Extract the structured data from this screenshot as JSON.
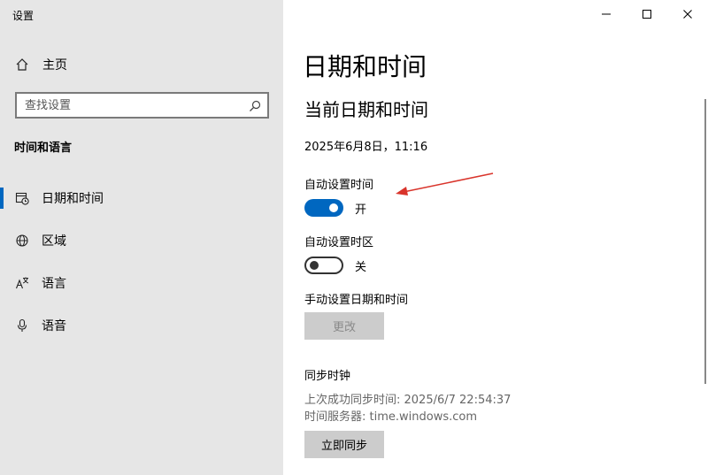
{
  "window": {
    "app_title": "设置",
    "minimize_glyph": "—",
    "maximize_glyph": "☐",
    "close_glyph": "✕"
  },
  "sidebar": {
    "home_label": "主页",
    "search_placeholder": "查找设置",
    "section_title": "时间和语言",
    "items": [
      {
        "label": "日期和时间",
        "icon": "calendar-clock-icon",
        "selected": true
      },
      {
        "label": "区域",
        "icon": "globe-icon",
        "selected": false
      },
      {
        "label": "语言",
        "icon": "language-icon",
        "selected": false
      },
      {
        "label": "语音",
        "icon": "microphone-icon",
        "selected": false
      }
    ]
  },
  "main": {
    "page_title": "日期和时间",
    "subtitle": "当前日期和时间",
    "current_datetime": "2025年6月8日，11:16",
    "auto_time": {
      "label": "自动设置时间",
      "state_label": "开",
      "on": true
    },
    "auto_timezone": {
      "label": "自动设置时区",
      "state_label": "关",
      "on": false
    },
    "manual": {
      "label": "手动设置日期和时间",
      "button_label": "更改"
    },
    "sync": {
      "title": "同步时钟",
      "last_sync": "上次成功同步时间: 2025/6/7 22:54:37",
      "server": "时间服务器: time.windows.com",
      "button_label": "立即同步"
    }
  },
  "colors": {
    "accent": "#0067c0",
    "sidebar_bg": "#e6e6e6",
    "annotation_arrow": "#d9342b"
  }
}
